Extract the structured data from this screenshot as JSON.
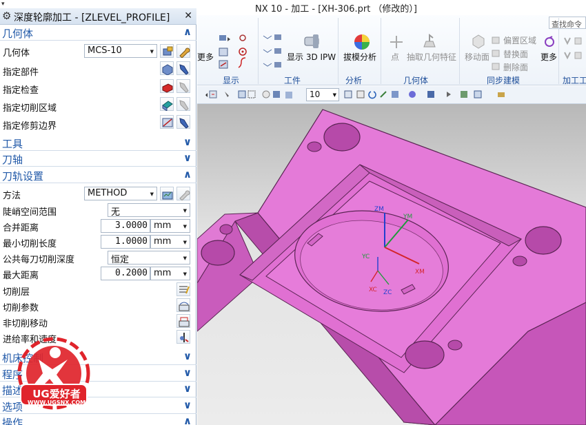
{
  "window": {
    "title": "NX 10 - 加工 - [XH-306.prt （修改的）]",
    "corner_glyph": "▾"
  },
  "ribbon": {
    "groups": [
      {
        "id": "display",
        "label": "显示"
      },
      {
        "id": "workpiece",
        "label": "工件"
      },
      {
        "id": "analysis",
        "label": "分析"
      },
      {
        "id": "geometry",
        "label": "几何体"
      },
      {
        "id": "sync",
        "label": "同步建模"
      },
      {
        "id": "machining_tools",
        "label": "加工工"
      }
    ],
    "more_left": "更多",
    "show_3d_ipw": "显示 3D IPW",
    "draft_analysis": "拔模分析",
    "point": "点",
    "extract_geometry": "抽取几何特征",
    "move_face": "移动面",
    "offset_region": "偏置区域",
    "replace_face": "替换面",
    "delete_face": "删除面",
    "more_right": "更多",
    "search_placeholder": "查找命令"
  },
  "toolbar": {
    "zoom_value": "10"
  },
  "dialog": {
    "title": "深度轮廓加工 - [ZLEVEL_PROFILE]",
    "sections": {
      "geometry": "几何体",
      "tool": "工具",
      "axis": "刀轴",
      "path_settings": "刀轨设置",
      "machine_control": "机床控制",
      "program": "程序",
      "description": "描述",
      "options": "选项",
      "actions": "操作"
    },
    "geometry": {
      "geometry_label": "几何体",
      "geometry_value": "MCS-10",
      "specify_part": "指定部件",
      "specify_check": "指定检查",
      "specify_cut_area": "指定切削区域",
      "specify_trim": "指定修剪边界"
    },
    "path": {
      "method_label": "方法",
      "method_value": "METHOD",
      "steep_label": "陡峭空间范围",
      "steep_value": "无",
      "merge_label": "合并距离",
      "merge_value": "3.0000",
      "merge_unit": "mm",
      "min_len_label": "最小切削长度",
      "min_len_value": "1.0000",
      "min_len_unit": "mm",
      "depth_label": "公共每刀切削深度",
      "depth_value": "恒定",
      "max_dist_label": "最大距离",
      "max_dist_value": "0.2000",
      "max_dist_unit": "mm",
      "cut_levels": "切削层",
      "cut_params": "切削参数",
      "non_cut": "非切削移动",
      "feeds": "进给率和速度"
    }
  },
  "viewport": {
    "part_color": "#e47ad8",
    "axes": {
      "zm": "ZM",
      "ym": "YM",
      "xm": "XM",
      "zc": "ZC",
      "yc": "YC",
      "xc": "XC"
    }
  },
  "watermark": {
    "text": "UG爱好者",
    "url": "WWW.UGSNX.COM",
    "color": "#e0242b"
  }
}
